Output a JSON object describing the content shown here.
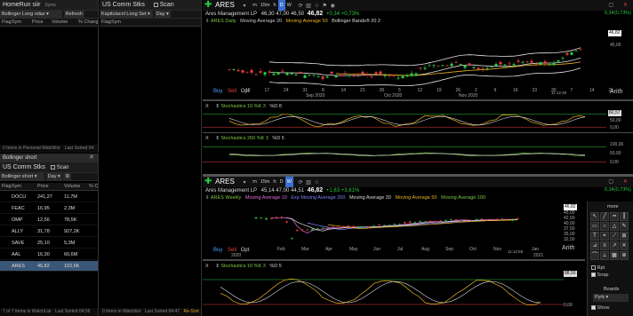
{
  "wl1": {
    "title": "HomeRun siir",
    "tag": "Syms",
    "scan_name": "Bollinger Long odaz",
    "refresh_label": "Refresh",
    "cols": [
      "Flag",
      "Sym",
      "Price",
      "Volume",
      "% Change"
    ],
    "footer_left": "0 Items in Personal Watchlist",
    "footer_right": "Last Sorted 04:"
  },
  "wl2": {
    "title": "US Comm Stks",
    "scan_label": "Scan",
    "scan_name": "Kapitulacnl Long Set",
    "period": "Day",
    "cols": [
      "Flag",
      "Sym"
    ],
    "footer_left": "0 Items in Watchlist",
    "footer_right": "Last Sorted 04:47"
  },
  "wl3": {
    "tab": "Bollinger short",
    "title": "US Comm Stks",
    "scan_label": "Scan",
    "scan_name": "Bollinger short",
    "period": "Day",
    "cols": [
      "Flag",
      "Sym",
      "Price",
      "Volume",
      "% Ch"
    ],
    "rows": [
      {
        "sym": "DOCU",
        "price": "241,27",
        "volume": "11,7M"
      },
      {
        "sym": "FEAC",
        "price": "16,95",
        "volume": "2,3M"
      },
      {
        "sym": "OMP",
        "price": "12,56",
        "volume": "78,5K"
      },
      {
        "sym": "ALLY",
        "price": "31,78",
        "volume": "927,2K"
      },
      {
        "sym": "SAVE",
        "price": "25,10",
        "volume": "5,3M"
      },
      {
        "sym": "AAL",
        "price": "16,30",
        "volume": "60,6M"
      },
      {
        "sym": "ARES",
        "price": "46,82",
        "volume": "102,6K"
      }
    ],
    "footer_left": "7 of 7 Items in WatchList",
    "footer_right": "Last Sorted 04:56",
    "status": "Re-Sort"
  },
  "chart1": {
    "symbol": "ARES",
    "periods": [
      "m",
      "15m",
      "h",
      "D",
      "W"
    ],
    "active_period": "D",
    "company": "Ares Management LP",
    "ohlc": "46,30  47,00  46,50",
    "last": "46,82",
    "change": "+0,34  +0,73%",
    "right_change": "0,34(0,73%)",
    "title_line": "ARES Daily",
    "studies": [
      "Moving Average 20",
      "Moving Average 50",
      "Bollinger Bands® 20 2"
    ],
    "buy": "Buy",
    "sell": "Sell",
    "opt": "Opt",
    "price_ticks": [
      "46,82",
      "45,00"
    ],
    "x_ticks": [
      "10",
      "17",
      "24",
      "31",
      "8",
      "14",
      "21",
      "28",
      "5",
      "12",
      "19",
      "26",
      "2",
      "9",
      "16",
      "23",
      "30",
      "7",
      "14",
      "21"
    ],
    "month_labels": [
      "Sep 2020",
      "Oct 2020",
      "Nov 2020"
    ],
    "time": "11:12:49",
    "scale": "Arith",
    "ind1_label": "Stochastics 10 %K 3",
    "ind1_sub": "%D 8",
    "ind1_ticks": [
      "82,57",
      "50,00",
      "0,00"
    ],
    "ind2_label": "Stochastics 260 %K 3",
    "ind2_sub": "%D 5",
    "ind2_ticks": [
      "100,00",
      "50,00",
      "0,00"
    ]
  },
  "chart2": {
    "symbol": "ARES",
    "company": "Ares Management LP",
    "ohlc": "45,14  47,00  44,51",
    "last": "46,82",
    "change": "+1,63  +3,61%",
    "right_change": "0,34(0,73%)",
    "title_line": "ARES Weekly",
    "studies": [
      "Moving Average 10",
      "Exp Moving Average 200",
      "Moving Average 20",
      "Moving Average 50",
      "Moving Average 100"
    ],
    "price_ticks": [
      "46,82",
      "45,00",
      "42,50",
      "40,00",
      "37,50",
      "35,00",
      "32,50",
      "30,00",
      "27,50",
      "25,00"
    ],
    "x_ticks": [
      "Feb",
      "Mar",
      "Apr",
      "May",
      "Jun",
      "Jul",
      "Aug",
      "Sep",
      "Oct",
      "Nov",
      "Jan"
    ],
    "year_labels": [
      "2020",
      "2021"
    ],
    "time": "11:12:59",
    "scale": "Arith",
    "ind1_label": "Stochastics 10 %K 3",
    "ind1_sub": "%D 5",
    "ind1_ticks": [
      "88,50",
      "0,00"
    ],
    "more": "more",
    "rpt": "Rpt",
    "snap": "Snap",
    "boards": "Boards",
    "board_val": "Pyrk",
    "show": "Show"
  },
  "colors": {
    "accent_green": "#2ecc40",
    "accent_red": "#e8403c",
    "bb": "#e6e6e6",
    "ma20": "#e8b020",
    "ma50": "#7ac943"
  }
}
